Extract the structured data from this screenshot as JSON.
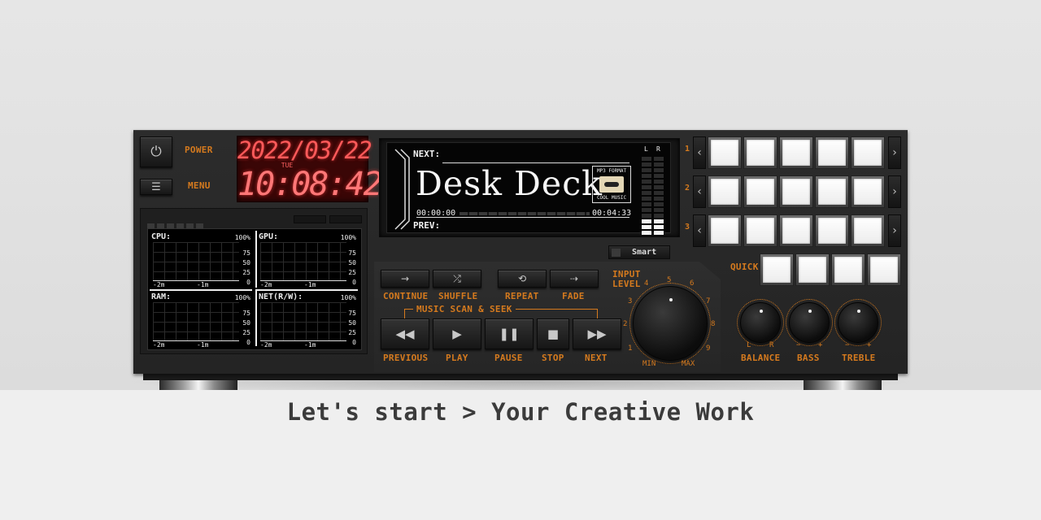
{
  "deck": {
    "power_label": "POWER",
    "menu_label": "MENU",
    "clock": {
      "date": "2022/03/22",
      "day": "TUE",
      "time": "10:08:42"
    },
    "monitor": {
      "graphs": [
        {
          "title": "CPU:",
          "pct": "100%",
          "yticks": [
            "75",
            "50",
            "25",
            "0"
          ],
          "xticks": [
            "-2m",
            "-1m"
          ]
        },
        {
          "title": "GPU:",
          "pct": "100%",
          "yticks": [
            "75",
            "50",
            "25",
            "0"
          ],
          "xticks": [
            "-2m",
            "-1m"
          ]
        },
        {
          "title": "RAM:",
          "pct": "100%",
          "yticks": [
            "75",
            "50",
            "25",
            "0"
          ],
          "xticks": [
            "-2m",
            "-1m"
          ]
        },
        {
          "title": "NET(R/W):",
          "pct": "100%",
          "yticks": [
            "75",
            "50",
            "25",
            "0"
          ],
          "xticks": [
            "-2m",
            "-1m"
          ]
        }
      ]
    },
    "display": {
      "next": "NEXT:",
      "prev": "PREV:",
      "title": "Desk Deck",
      "time_start": "00:00:00",
      "time_end": "00:04:33",
      "cassette_top": "MP3 FORMAT",
      "cassette_bottom": "COOL MUSIC",
      "meter_l": "L",
      "meter_r": "R",
      "meter_level": 0.2
    },
    "smart_label": "Smart",
    "modes": [
      {
        "label": "CONTINUE",
        "icon": "arrow-right-icon"
      },
      {
        "label": "SHUFFLE",
        "icon": "shuffle-icon"
      },
      {
        "label": "REPEAT",
        "icon": "repeat-icon"
      },
      {
        "label": "FADE",
        "icon": "fade-icon"
      }
    ],
    "scan_label": "MUSIC SCAN & SEEK",
    "transport": [
      {
        "label": "PREVIOUS",
        "icon": "rewind-icon"
      },
      {
        "label": "PLAY",
        "icon": "play-icon"
      },
      {
        "label": "PAUSE",
        "icon": "pause-icon"
      },
      {
        "label": "STOP",
        "icon": "stop-icon"
      },
      {
        "label": "NEXT",
        "icon": "fast-forward-icon"
      }
    ],
    "input_level": {
      "label_1": "INPUT",
      "label_2": "LEVEL",
      "scale": [
        "1",
        "2",
        "3",
        "4",
        "5",
        "6",
        "7",
        "8",
        "9"
      ],
      "min": "MIN",
      "max": "MAX"
    },
    "tone": [
      {
        "label": "BALANCE",
        "left": "L",
        "right": "R"
      },
      {
        "label": "BASS",
        "left": "−",
        "right": "+"
      },
      {
        "label": "TREBLE",
        "left": "−",
        "right": "+"
      }
    ],
    "pads": {
      "rows": [
        "1",
        "2",
        "3"
      ],
      "quick_label": "QUICK"
    }
  },
  "tagline": "Let's start > Your Creative Work",
  "colors": {
    "accent": "#d57a1e",
    "clock_red": "#ff5a5a",
    "body": "#2a2a2a"
  }
}
